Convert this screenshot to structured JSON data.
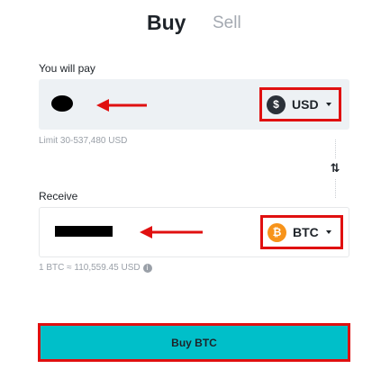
{
  "tabs": {
    "buy": "Buy",
    "sell": "Sell"
  },
  "pay": {
    "label": "You will pay",
    "currency": "USD",
    "currency_icon": "dollar-coin-icon",
    "coin_symbol": "$",
    "limit": "Limit 30-537,480 USD"
  },
  "receive": {
    "label": "Receive",
    "currency": "BTC",
    "currency_icon": "bitcoin-coin-icon",
    "coin_symbol": "₿",
    "rate": "1 BTC ≈ 110,559.45 USD"
  },
  "swap_icon": "⇅",
  "buy_button": "Buy BTC",
  "colors": {
    "accent": "#00bfc9",
    "highlight": "#e01010",
    "btc": "#f7931a",
    "usd_coin": "#2b3139"
  }
}
